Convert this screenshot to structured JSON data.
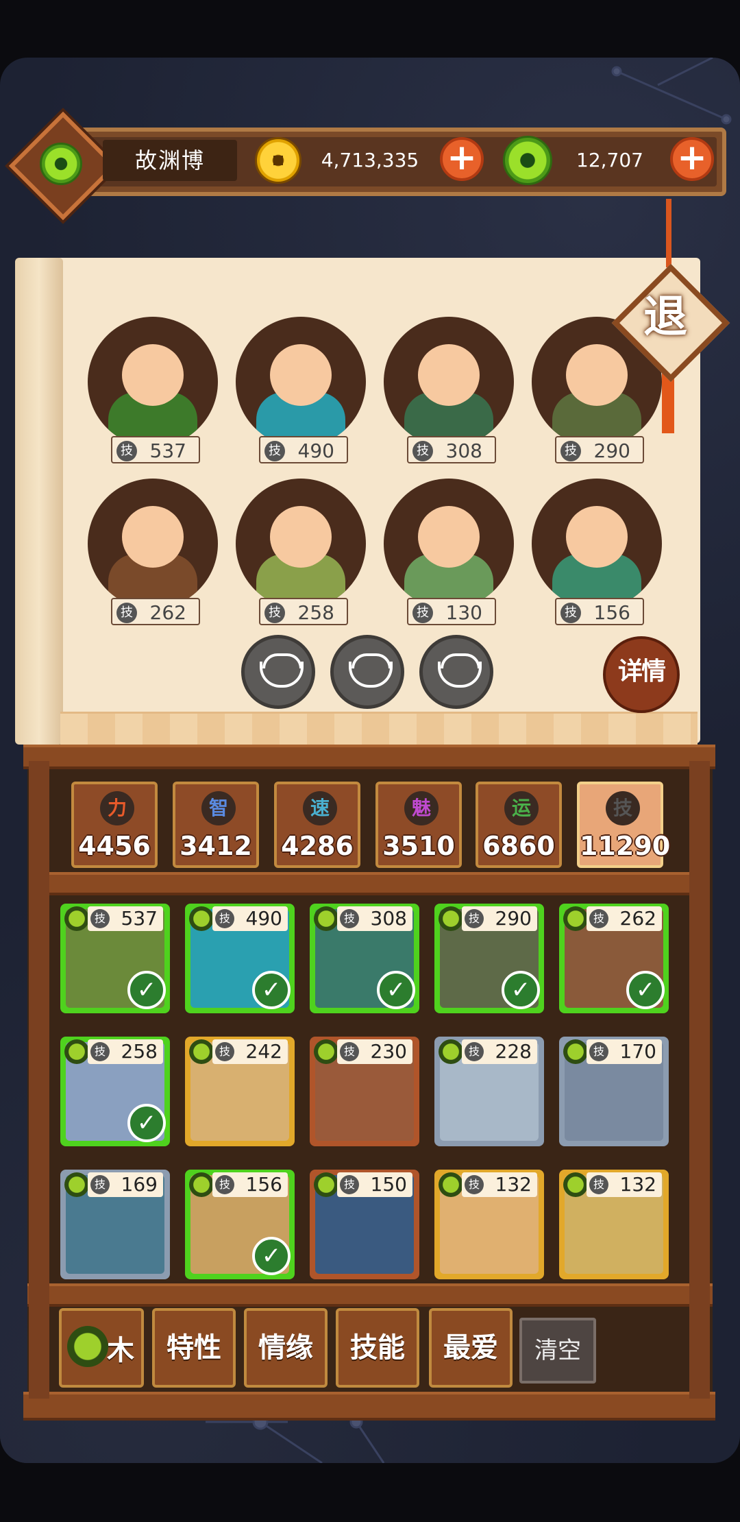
{
  "player": {
    "name": "故渊博",
    "coins": "4,713,335",
    "jade": "12,707"
  },
  "exit_label": "退",
  "detail_label": "详情",
  "team": [
    {
      "skill": "537",
      "color": "#3d7a2a"
    },
    {
      "skill": "490",
      "color": "#2a9aa8"
    },
    {
      "skill": "308",
      "color": "#3a6a48"
    },
    {
      "skill": "290",
      "color": "#5a6a3a"
    },
    {
      "skill": "262",
      "color": "#7a4a2a"
    },
    {
      "skill": "258",
      "color": "#8aa04a"
    },
    {
      "skill": "130",
      "color": "#6a9a5a"
    },
    {
      "skill": "156",
      "color": "#3a8a6a"
    }
  ],
  "skill_char": "技",
  "stats": [
    {
      "icon": "力",
      "value": "4456",
      "icon_color": "#e85a2a"
    },
    {
      "icon": "智",
      "value": "3412",
      "icon_color": "#5a8ae0"
    },
    {
      "icon": "速",
      "value": "4286",
      "icon_color": "#4ab0d0"
    },
    {
      "icon": "魅",
      "value": "3510",
      "icon_color": "#c04ad0"
    },
    {
      "icon": "运",
      "value": "6860",
      "icon_color": "#4ab04a"
    },
    {
      "icon": "技",
      "value": "11290",
      "icon_color": "#555555"
    }
  ],
  "roster": [
    {
      "skill": "537",
      "selected": true,
      "frame": "#4fd21e",
      "art": "#6b8a3a"
    },
    {
      "skill": "490",
      "selected": true,
      "frame": "#4fd21e",
      "art": "#2aa0b0"
    },
    {
      "skill": "308",
      "selected": true,
      "frame": "#4fd21e",
      "art": "#3a7a6a"
    },
    {
      "skill": "290",
      "selected": true,
      "frame": "#4fd21e",
      "art": "#5e6a48"
    },
    {
      "skill": "262",
      "selected": true,
      "frame": "#4fd21e",
      "art": "#8a5a3a"
    },
    {
      "skill": "258",
      "selected": true,
      "frame": "#4fd21e",
      "art": "#8aa0c0"
    },
    {
      "skill": "242",
      "selected": false,
      "frame": "#e2a82a",
      "art": "#d8b070"
    },
    {
      "skill": "230",
      "selected": false,
      "frame": "#b0552a",
      "art": "#9a5a3a"
    },
    {
      "skill": "228",
      "selected": false,
      "frame": "#8c9cb0",
      "art": "#a8b8c8"
    },
    {
      "skill": "170",
      "selected": false,
      "frame": "#8c9cb0",
      "art": "#7a8aa0"
    },
    {
      "skill": "169",
      "selected": false,
      "frame": "#8c9cb0",
      "art": "#4a7a90"
    },
    {
      "skill": "156",
      "selected": true,
      "frame": "#4fd21e",
      "art": "#c8a060"
    },
    {
      "skill": "150",
      "selected": false,
      "frame": "#b0552a",
      "art": "#3a5a80"
    },
    {
      "skill": "132",
      "selected": false,
      "frame": "#e2a82a",
      "art": "#e0b070"
    },
    {
      "skill": "132",
      "selected": false,
      "frame": "#e2a82a",
      "art": "#d0b060"
    }
  ],
  "filters": {
    "element": "木",
    "trait": "特性",
    "bond": "情缘",
    "skill": "技能",
    "favorite": "最爱",
    "clear": "清空"
  }
}
